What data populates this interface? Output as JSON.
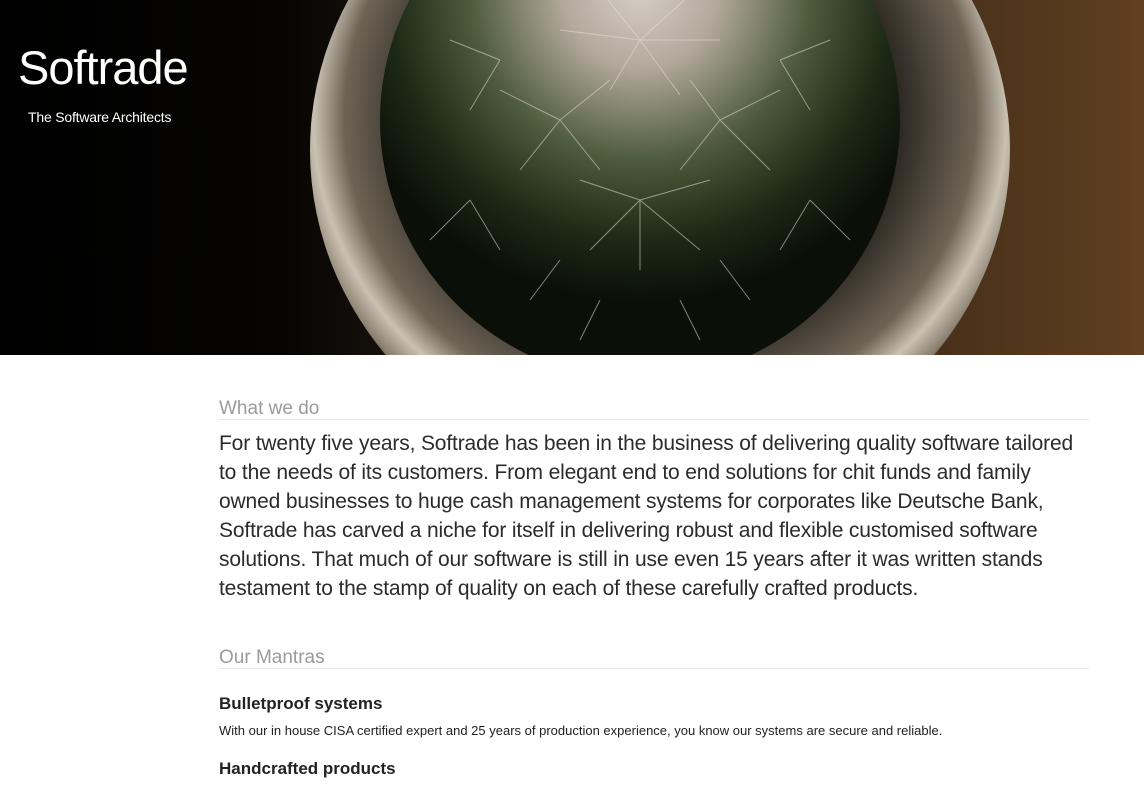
{
  "brand": {
    "title": "Softrade",
    "tagline": "The Software Architects"
  },
  "what_we_do": {
    "heading": "What we do",
    "body": "For twenty five years, Softrade has been in the business of delivering quality software tailored to the needs of its customers. From elegant end to end solutions for chit funds and family owned businesses to huge cash management systems for corporates like Deutsche Bank, Softrade has carved a niche for itself in delivering robust and flexible customised software solutions. That much of our software is still in use even 15 years after it was written stands testament to the stamp of quality on each of these carefully crafted products."
  },
  "mantras": {
    "heading": "Our Mantras",
    "items": [
      {
        "title": "Bulletproof systems",
        "text": "With our in house CISA certified expert and 25 years of production experience, you know our systems are secure and reliable."
      },
      {
        "title": "Handcrafted products",
        "text": ""
      }
    ]
  }
}
